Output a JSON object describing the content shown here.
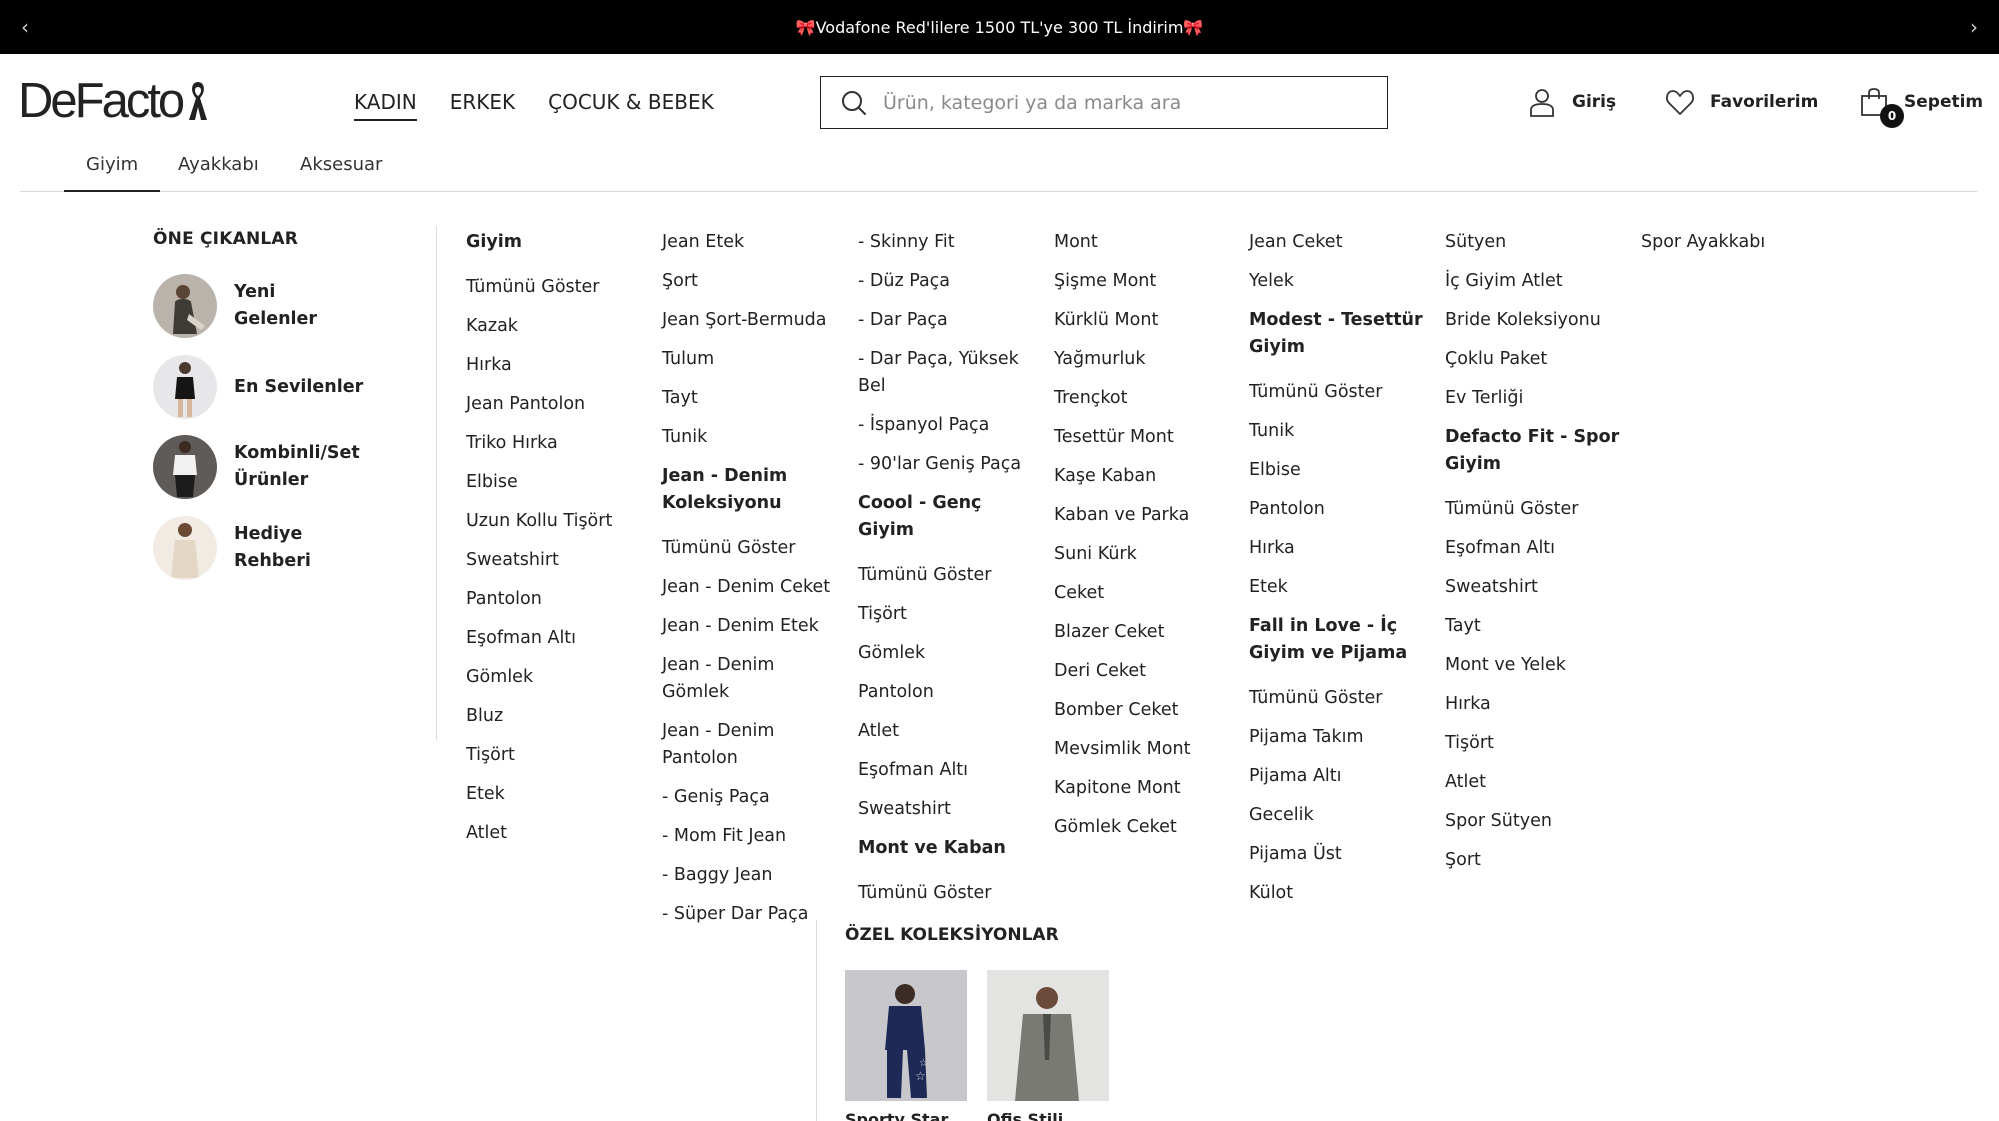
{
  "announcement": {
    "text": "🎀Vodafone Red'lilere 1500 TL'ye 300 TL İndirim🎀",
    "prev_icon": "chevron-left-icon",
    "next_icon": "chevron-right-icon"
  },
  "brand": {
    "logo_text": "DeFacto"
  },
  "main_nav": [
    {
      "label": "KADIN",
      "active": true
    },
    {
      "label": "ERKEK",
      "active": false
    },
    {
      "label": "ÇOCUK & BEBEK",
      "active": false
    }
  ],
  "search": {
    "placeholder": "Ürün, kategori ya da marka ara",
    "value": ""
  },
  "actions": {
    "login": "Giriş",
    "favorites": "Favorilerim",
    "cart": "Sepetim",
    "cart_count": "0"
  },
  "sub_nav": [
    {
      "label": "Giyim",
      "active": true
    },
    {
      "label": "Ayakkabı",
      "active": false
    },
    {
      "label": "Aksesuar",
      "active": false
    }
  ],
  "featured": {
    "title": "ÖNE ÇIKANLAR",
    "items": [
      "Yeni Gelenler",
      "En Sevilenler",
      "Kombinli/Set Ürünler",
      "Hediye Rehberi"
    ]
  },
  "columns": [
    [
      "Giyim",
      "Tümünü Göster",
      "Kazak",
      "Hırka",
      "Jean Pantolon",
      "Triko Hırka",
      "Elbise",
      "Uzun Kollu Tişört",
      "Sweatshirt",
      "Pantolon",
      "Eşofman Altı",
      "Gömlek",
      "Bluz",
      "Tişört",
      "Etek",
      "Atlet"
    ],
    [
      "Jean Etek",
      "Şort",
      "Jean Şort-Bermuda",
      "Tulum",
      "Tayt",
      "Tunik",
      "Jean - Denim Koleksiyonu",
      "Tümünü Göster",
      "Jean - Denim Ceket",
      "Jean - Denim Etek",
      "Jean - Denim Gömlek",
      "Jean - Denim Pantolon",
      "- Geniş Paça",
      "- Mom Fit Jean",
      "- Baggy Jean",
      "- Süper Dar Paça"
    ],
    [
      "- Skinny Fit",
      "- Düz Paça",
      "- Dar Paça",
      "- Dar Paça, Yüksek Bel",
      "- İspanyol Paça",
      "- 90'lar Geniş Paça",
      "Coool - Genç Giyim",
      "Tümünü Göster",
      "Tişört",
      "Gömlek",
      "Pantolon",
      "Atlet",
      "Eşofman Altı",
      "Sweatshirt",
      "Mont ve Kaban",
      "Tümünü Göster"
    ],
    [
      "Mont",
      "Şişme Mont",
      "Kürklü Mont",
      "Yağmurluk",
      "Trençkot",
      "Tesettür Mont",
      "Kaşe Kaban",
      "Kaban ve Parka",
      "Suni Kürk",
      "Ceket",
      "Blazer Ceket",
      "Deri Ceket",
      "Bomber Ceket",
      "Mevsimlik Mont",
      "Kapitone Mont",
      "Gömlek Ceket"
    ],
    [
      "Jean Ceket",
      "Yelek",
      "Modest - Tesettür Giyim",
      "Tümünü Göster",
      "Tunik",
      "Elbise",
      "Pantolon",
      "Hırka",
      "Etek",
      "Fall in Love - İç Giyim ve Pijama",
      "Tümünü Göster",
      "Pijama Takım",
      "Pijama Altı",
      "Gecelik",
      "Pijama Üst",
      "Külot"
    ],
    [
      "Sütyen",
      "İç Giyim Atlet",
      "Bride Koleksiyonu",
      "Çoklu Paket",
      "Ev Terliği",
      "Defacto Fit - Spor Giyim",
      "Tümünü Göster",
      "Eşofman Altı",
      "Sweatshirt",
      "Tayt",
      "Mont ve Yelek",
      "Hırka",
      "Tişört",
      "Atlet",
      "Spor Sütyen",
      "Şort"
    ],
    [
      "Spor Ayakkabı"
    ]
  ],
  "special_collections": {
    "title": "ÖZEL KOLEKSİYONLAR",
    "items": [
      "Sporty Star",
      "Ofis Stili"
    ]
  }
}
